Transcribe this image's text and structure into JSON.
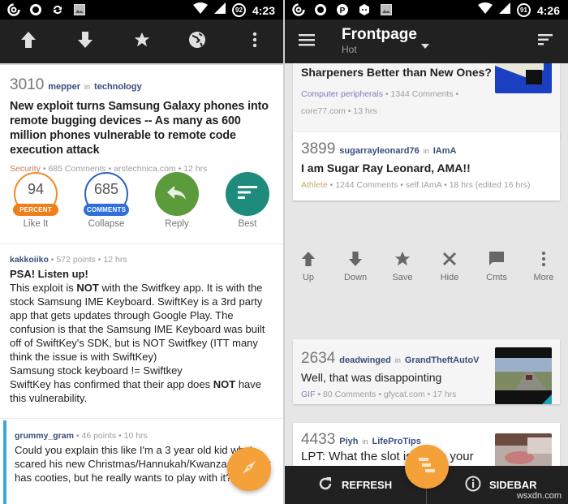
{
  "left": {
    "statusbar": {
      "time": "4:23",
      "battery": "92",
      "notification_icons": [
        "pocketcasts-icon",
        "circle-icon",
        "sync-icon",
        "image-icon"
      ]
    },
    "toolbar": {
      "buttons": [
        "upvote-icon",
        "downvote-icon",
        "star-icon",
        "globe-icon",
        "more-vert-icon"
      ]
    },
    "post": {
      "score": "3010",
      "author": "mepper",
      "in": "in",
      "subreddit": "technology",
      "title": "New exploit turns Samsung Galaxy phones into remote bugging devices -- As many as 600 million phones vulnerable to remote code execution attack",
      "flair": "Security",
      "comments": "685 Comments",
      "domain": "arstechnica.com",
      "age": "12 hrs"
    },
    "actions": {
      "like": {
        "value": "94",
        "tag": "PERCENT",
        "label": "Like It",
        "color": "#ef7f1a"
      },
      "collapse": {
        "value": "685",
        "tag": "COMMENTS",
        "label": "Collapse",
        "color": "#2f6fdc"
      },
      "reply": {
        "label": "Reply",
        "color": "#5b9b3c"
      },
      "best": {
        "label": "Best",
        "color": "#1e8b7c"
      }
    },
    "comments": [
      {
        "author": "kakkoiiko",
        "points": "572 points",
        "age": "12 hrs",
        "title": "PSA! Listen up!",
        "body_parts": [
          "This exploit is ",
          "NOT",
          " with the Switfkey app. It is with the stock Samsung IME Keyboard. SwiftKey is a 3rd party app that gets updates through Google Play. The confusion is that the Samsung IME Keyboard was built off of SwiftKey's SDK, but is NOT Switfkey (ITT many think the issue is with SwiftKey)",
          "Samsung stock keyboard != Swiftkey",
          "SwiftKey has confirmed that their app does ",
          "NOT",
          " have this vulnerability."
        ]
      },
      {
        "author": "grummy_gram",
        "points": "46 points",
        "age": "10 hrs",
        "body": "Could you explain this like I'm a 3 year old kid who's scared his new Christmas/Hannukah/Kwanzaa present has cooties, but he really wants to play with it?"
      }
    ],
    "fab": {
      "icon": "compass-icon",
      "color": "#f4a13a"
    }
  },
  "right": {
    "statusbar": {
      "time": "4:26",
      "battery": "91",
      "notification_icons": [
        "pocketcasts-icon",
        "circle-icon",
        "pinterest-icon",
        "hexagon-icon",
        "image-icon"
      ]
    },
    "toolbar": {
      "title": "Frontpage",
      "subtitle": "Hot"
    },
    "posts": [
      {
        "title": "Sharpeners Better than New Ones?",
        "flair": "Computer peripherals",
        "comments": "1344 Comments",
        "domain": "core77.com",
        "age": "13 hrs"
      },
      {
        "score": "3899",
        "author": "sugarrayleonard76",
        "in": "in",
        "subreddit": "IAmA",
        "title": "I am Sugar Ray Leonard, AMA!!",
        "flair": "Athlete",
        "comments": "1244 Comments",
        "domain": "self.IAmA",
        "age": "18 hrs (edited 16 hrs)"
      },
      {
        "score": "2634",
        "author": "deadwinged",
        "in": "in",
        "subreddit": "GrandTheftAutoV",
        "title": "Well, that was disappointing",
        "flair": "GIF",
        "comments": "80 Comments",
        "domain": "gfycat.com",
        "age": "17 hrs"
      },
      {
        "score": "4433",
        "author": "Piyh",
        "in": "in",
        "subreddit": "LifeProTips",
        "title": "LPT: What the slot is for on your"
      }
    ],
    "quick_actions": [
      {
        "icon": "upvote-icon",
        "label": "Up"
      },
      {
        "icon": "downvote-icon",
        "label": "Down"
      },
      {
        "icon": "star-icon",
        "label": "Save"
      },
      {
        "icon": "close-icon",
        "label": "Hide"
      },
      {
        "icon": "comment-icon",
        "label": "Cmts"
      },
      {
        "icon": "more-vert-icon",
        "label": "More"
      }
    ],
    "bottombar": {
      "refresh": "REFRESH",
      "sidebar": "SIDEBAR"
    },
    "fab": {
      "icon": "subreddit-list-icon",
      "color": "#f4a13a"
    }
  },
  "watermark": "wsxdn.com",
  "separator": "•"
}
